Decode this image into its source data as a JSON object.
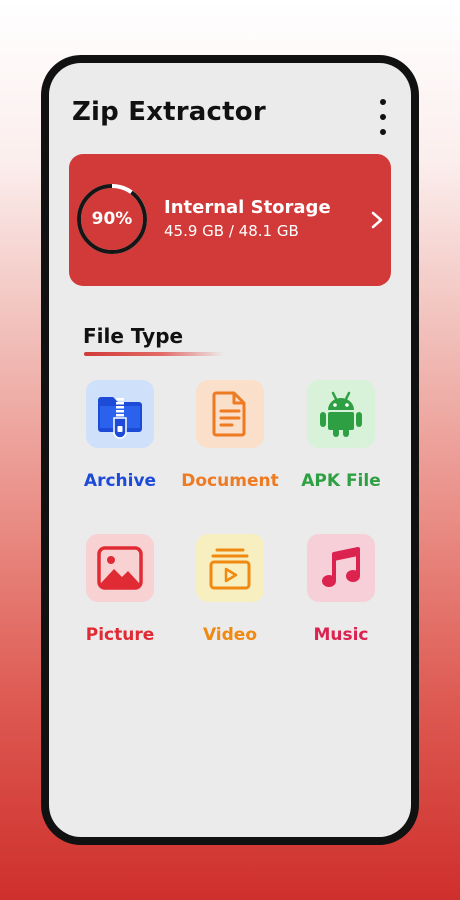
{
  "app": {
    "title": "Zip Extractor"
  },
  "storage": {
    "percent_label": "90%",
    "percent": 90,
    "title": "Internal Storage",
    "usage": "45.9 GB / 48.1 GB"
  },
  "file_types": {
    "heading": "File Type",
    "items": [
      {
        "label": "Archive",
        "icon": "folder-zip-icon",
        "color": "#1d4bd8",
        "tile_bg": "#cfe0fb"
      },
      {
        "label": "Document",
        "icon": "document-icon",
        "color": "#ee7a22",
        "tile_bg": "#fadfca"
      },
      {
        "label": "APK File",
        "icon": "android-icon",
        "color": "#2ea043",
        "tile_bg": "#d7f2d9"
      },
      {
        "label": "Picture",
        "icon": "picture-icon",
        "color": "#e02b35",
        "tile_bg": "#f8d2d3"
      },
      {
        "label": "Video",
        "icon": "video-icon",
        "color": "#f0890f",
        "tile_bg": "#f7efbf"
      },
      {
        "label": "Music",
        "icon": "music-icon",
        "color": "#dc2350",
        "tile_bg": "#f6cfd8"
      }
    ]
  },
  "colors": {
    "accent": "#d13a38",
    "screen_bg": "#ebebeb"
  }
}
